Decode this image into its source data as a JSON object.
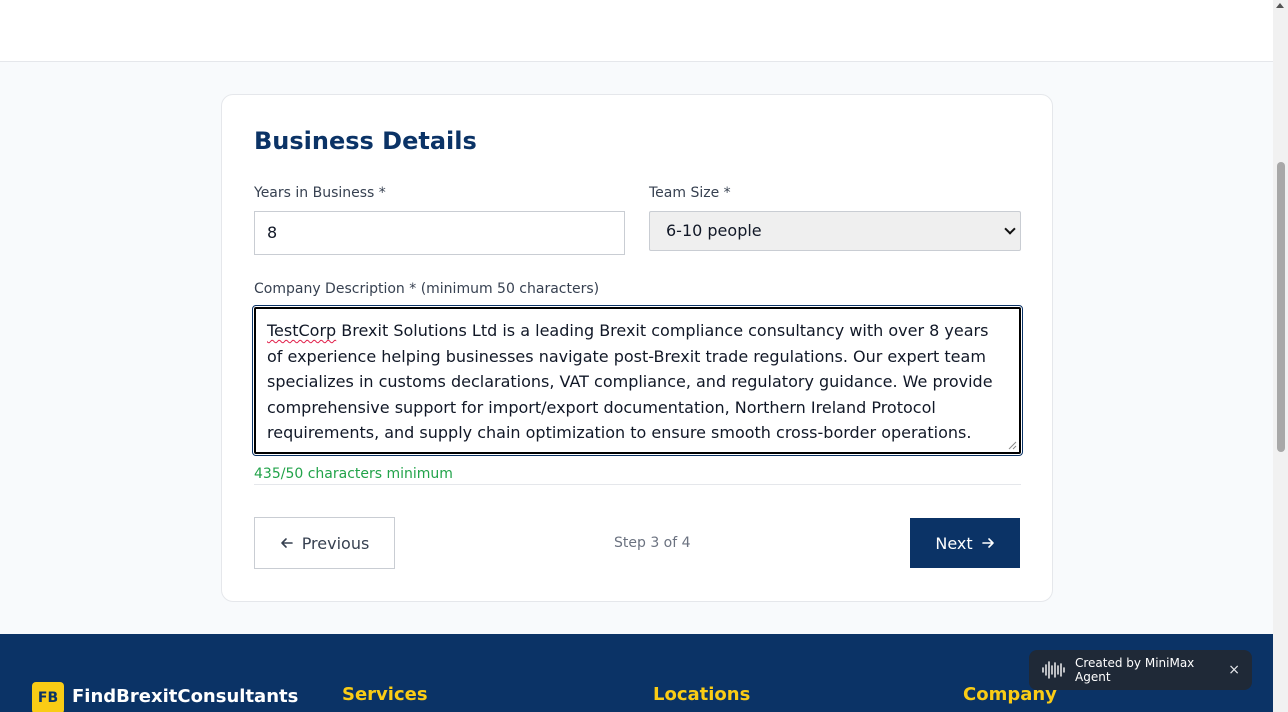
{
  "form": {
    "title": "Business Details",
    "years_label": "Years in Business *",
    "years_value": "8",
    "team_label": "Team Size *",
    "team_value": "6-10 people",
    "description_label": "Company Description * (minimum 50 characters)",
    "description_first_word": "TestCorp",
    "description_rest": " Brexit Solutions Ltd is a leading Brexit compliance consultancy with over 8 years of experience helping businesses navigate post-Brexit trade regulations. Our expert team specializes in customs declarations, VAT compliance, and regulatory guidance. We provide comprehensive support for import/export documentation, Northern Ireland Protocol requirements, and supply chain optimization to ensure smooth cross-border operations.",
    "char_count": "435/50 characters minimum",
    "prev_label": "Previous",
    "step_text": "Step 3 of 4",
    "next_label": "Next"
  },
  "footer": {
    "logo_initials": "FB",
    "brand": "FindBrexitConsultants",
    "col1": "Services",
    "col2": "Locations",
    "col3": "Company"
  },
  "toast": {
    "text": "Created by MiniMax Agent",
    "close": "×"
  },
  "icons": {
    "prev": "arrow-left-icon",
    "next": "arrow-right-icon",
    "toast": "waveform-icon"
  }
}
